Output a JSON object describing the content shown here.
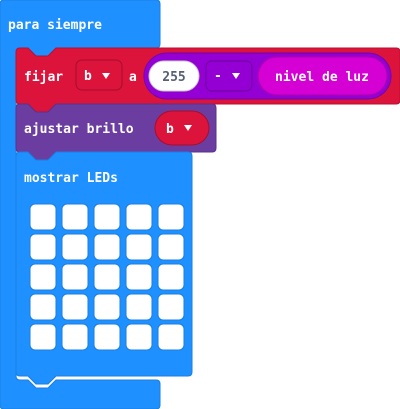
{
  "forever_block": {
    "label": "para siempre",
    "color": "#1e90ff"
  },
  "set_block": {
    "label": "fijar",
    "variable": "b",
    "to_label": "a",
    "color": "#dc143c",
    "operator": {
      "value": "255",
      "symbol": "-",
      "color": "#9400d3"
    },
    "reporter": {
      "label": "nivel de luz",
      "color": "#d400d4"
    }
  },
  "brightness_block": {
    "label": "ajustar brillo",
    "variable": "b",
    "color": "#6c3da0"
  },
  "show_leds_block": {
    "label": "mostrar LEDs",
    "color": "#1e90ff",
    "grid": {
      "rows": 5,
      "cols": 5,
      "lit": [
        [
          0,
          0,
          0,
          0,
          0
        ],
        [
          0,
          0,
          0,
          0,
          0
        ],
        [
          0,
          0,
          0,
          0,
          0
        ],
        [
          0,
          0,
          0,
          0,
          0
        ],
        [
          0,
          0,
          0,
          0,
          0
        ]
      ]
    }
  },
  "icons": {
    "dropdown": "dropdown-arrow-icon"
  }
}
